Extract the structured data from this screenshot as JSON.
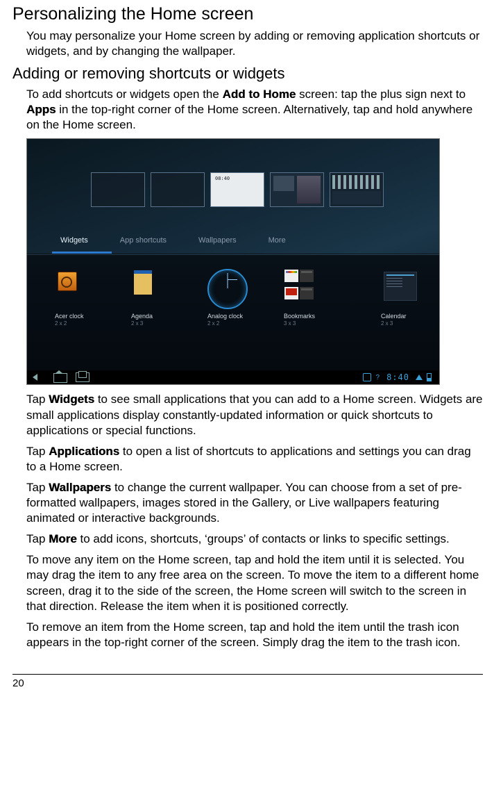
{
  "heading1": "Personalizing the Home screen",
  "p1": "You may personalize your Home screen by adding or removing application shortcuts or widgets, and by changing the wallpaper.",
  "heading2": "Adding or removing shortcuts or widgets",
  "p2a": "To add shortcuts or widgets open the ",
  "p2b": "Add to Home",
  "p2c": " screen: tap the plus sign next to ",
  "p2d": "Apps",
  "p2e": " in the top-right corner of the Home screen. Alternatively, tap and hold anywhere on the Home screen.",
  "shot": {
    "panel_clock": "08:40",
    "tabs": {
      "widgets": "Widgets",
      "shortcuts": "App shortcuts",
      "wallpapers": "Wallpapers",
      "more": "More"
    },
    "widgets": [
      {
        "name": "Acer clock",
        "size": "2 x 2"
      },
      {
        "name": "Agenda",
        "size": "2 x 3"
      },
      {
        "name": "Analog clock",
        "size": "2 x 2"
      },
      {
        "name": "Bookmarks",
        "size": "3 x 3"
      },
      {
        "name": "Calendar",
        "size": "2 x 3"
      }
    ],
    "sys_time": "8:40",
    "sys_q": "?"
  },
  "p3a": "Tap ",
  "p3b": "Widgets",
  "p3c": " to see small applications that you can add to a Home screen. Widgets are small applications display constantly-updated information or quick shortcuts to applications or special functions.",
  "p4a": "Tap ",
  "p4b": "Applications",
  "p4c": " to open a list of shortcuts to applications and settings you can drag to a Home screen.",
  "p5a": "Tap ",
  "p5b": "Wallpapers",
  "p5c": " to change the current wallpaper. You can choose from a set of pre-formatted wallpapers, images stored in the Gallery, or Live wallpapers featuring animated or interactive backgrounds.",
  "p6a": "Tap ",
  "p6b": "More",
  "p6c": " to add icons, shortcuts, ‘groups’ of contacts or links to specific settings.",
  "p7": "To move any item on the Home screen, tap and hold the item until it is selected. You may drag the item to any free area on the screen. To move the item to a different home screen, drag it to the side of the screen, the Home screen will switch to the screen in that direction. Release the item when it is positioned correctly.",
  "p8": "To remove an item from the Home screen, tap and hold the item until the trash icon appears in the top-right corner of the screen. Simply drag the item to the trash icon.",
  "page_number": "20"
}
